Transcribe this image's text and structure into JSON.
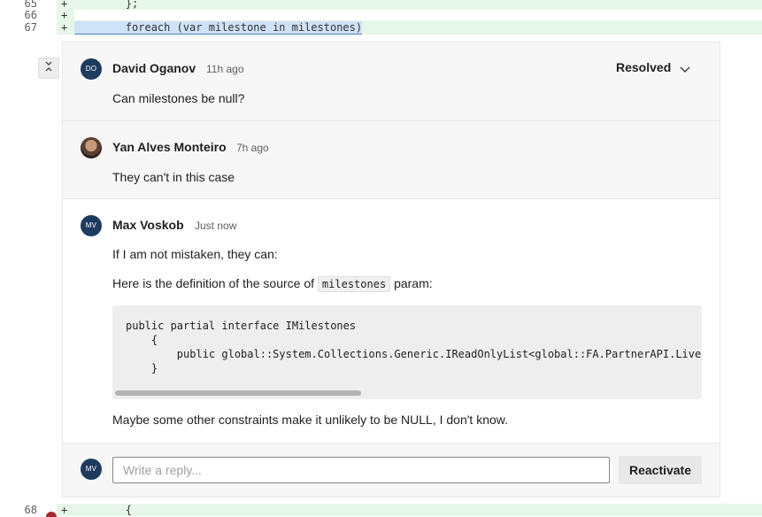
{
  "diff": {
    "lines": [
      {
        "number": "65",
        "marker": "+",
        "code": "        };"
      },
      {
        "number": "66",
        "marker": "+",
        "code": ""
      },
      {
        "number": "67",
        "marker": "+",
        "code": "        foreach (var milestone in milestones)"
      },
      {
        "number": "68",
        "marker": "+",
        "code": "        {"
      }
    ],
    "added_color": "#e6f7e9"
  },
  "thread": {
    "status": "Resolved",
    "comments": [
      {
        "initials": "DO",
        "author": "David Oganov",
        "time": "11h ago",
        "text": "Can milestones be null?"
      },
      {
        "initials": "",
        "author": "Yan Alves Monteiro",
        "time": "7h ago",
        "text": "They can't in this case"
      },
      {
        "initials": "MV",
        "author": "Max Voskob",
        "time": "Just now",
        "p1": "If I am not mistaken, they can:",
        "p2_before": "Here is the definition of the source of",
        "p2_code": "milestones",
        "p2_after": "param:",
        "code_block": "public partial interface IMilestones\n    {\n        public global::System.Collections.Generic.IReadOnlyList<global::FA.PartnerAPI.LiveS\n    }",
        "p3": "Maybe some other constraints make it unlikely to be NULL, I don't know."
      }
    ],
    "reply": {
      "initials": "MV",
      "placeholder": "Write a reply...",
      "value": "",
      "button_label": "Reactivate"
    }
  },
  "icons": {
    "collapse": "collapse-icon",
    "status_dropdown": "chevron-down-icon",
    "avatar_photo": "avatar-photo"
  },
  "colors": {
    "avatar": "#1f3a5f",
    "accent_selection": "#cfe2f7"
  }
}
